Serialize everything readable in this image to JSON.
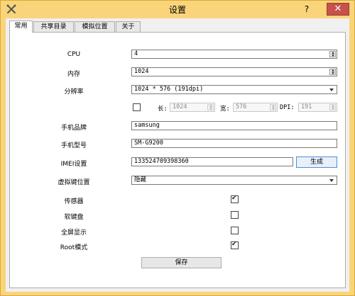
{
  "window": {
    "title": "设置",
    "help_label": "?",
    "close_label": "✕"
  },
  "tabs": [
    {
      "label": "常用"
    },
    {
      "label": "共享目录"
    },
    {
      "label": "模拟位置"
    },
    {
      "label": "关于"
    }
  ],
  "settings": {
    "cpu": {
      "label": "CPU",
      "value": "4"
    },
    "memory": {
      "label": "内存",
      "value": "1024"
    },
    "resolution": {
      "label": "分辨率",
      "value": "1024 * 576 (191dpi)"
    },
    "custom_resolution": {
      "checked": false,
      "length_label": "长:",
      "length_value": "1024",
      "width_label": "宽:",
      "width_value": "576",
      "dpi_label": "DPI:",
      "dpi_value": "191"
    },
    "brand": {
      "label": "手机品牌",
      "value": "samsung"
    },
    "model": {
      "label": "手机型号",
      "value": "SM-G9200"
    },
    "imei": {
      "label": "IMEI设置",
      "value": "133524709398360",
      "generate_label": "生成"
    },
    "virtual_keys": {
      "label": "虚拟键位置",
      "value": "隐藏"
    },
    "sensor": {
      "label": "传感器",
      "checked": true
    },
    "soft_keyboard": {
      "label": "软键盘",
      "checked": false
    },
    "fullscreen": {
      "label": "全屏显示",
      "checked": false
    },
    "root_mode": {
      "label": "Root模式",
      "checked": true
    }
  },
  "save_label": "保存",
  "icons": {
    "app": "tools-icon",
    "help": "help-icon",
    "close": "close-icon"
  },
  "colors": {
    "titlebar": "#f9d47a",
    "close_button": "#c7514b"
  }
}
